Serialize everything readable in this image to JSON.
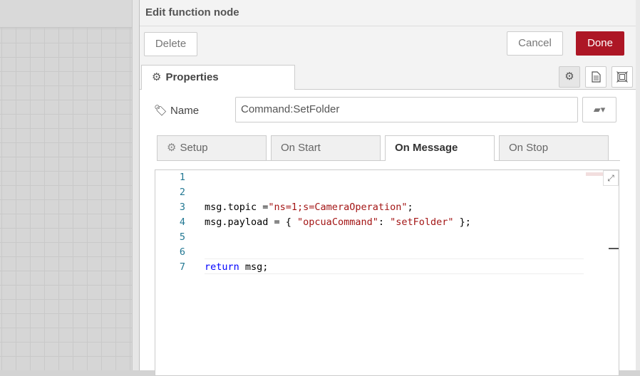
{
  "tray": {
    "title": "Edit function node"
  },
  "toolbar": {
    "delete_label": "Delete",
    "cancel_label": "Cancel",
    "done_label": "Done"
  },
  "tabs": {
    "properties_label": "Properties"
  },
  "name_field": {
    "label": "Name",
    "value": "Command:SetFolder"
  },
  "subtabs": [
    "Setup",
    "On Start",
    "On Message",
    "On Stop"
  ],
  "editor": {
    "line_numbers": [
      "1",
      "2",
      "3",
      "4",
      "5",
      "6",
      "7"
    ]
  },
  "colors": {
    "done_button": "#ad1625",
    "string": "#a31515",
    "keyword": "#0000ff",
    "line_number": "#237893"
  },
  "icons": [
    "gear-icon",
    "document-icon",
    "frame-icon",
    "tag-icon",
    "book-icon",
    "chevron-down-icon",
    "expand-icon"
  ]
}
